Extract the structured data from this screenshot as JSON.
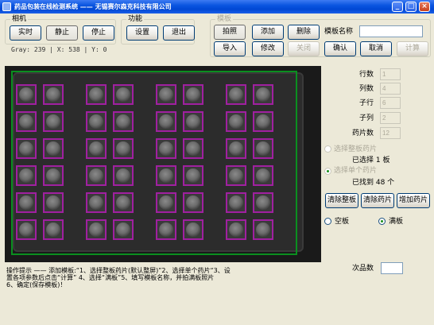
{
  "window": {
    "title": "药品包装在线检测系统  ——  无锡赛尔森克科技有限公司"
  },
  "camera_group": {
    "legend": "相机",
    "realtime_label": "实时",
    "still_label": "静止",
    "stop_label": "停止"
  },
  "function_group": {
    "legend": "功能",
    "settings_label": "设置",
    "exit_label": "退出"
  },
  "template_group": {
    "legend": "模板",
    "capture_label": "拍照",
    "add_label": "添加",
    "delete_label": "删除",
    "name_label": "模板名称",
    "name_value": "",
    "import_label": "导入",
    "modify_label": "修改",
    "close_label": "关闭",
    "confirm_label": "确认",
    "cancel_label": "取消",
    "calculate_label": "计算"
  },
  "status_bar": {
    "text": "Gray: 239 | X: 538 | Y: 0"
  },
  "params": [
    {
      "label": "行数",
      "value": "1"
    },
    {
      "label": "列数",
      "value": "4"
    },
    {
      "label": "子行",
      "value": "6"
    },
    {
      "label": "子列",
      "value": "2"
    },
    {
      "label": "药片数",
      "value": "12"
    }
  ],
  "selection": {
    "select_whole_label": "选择整板药片",
    "selected_boards": "已选择 1 板",
    "select_single_label": "选择单个药片",
    "found_count": "已找到 48 个"
  },
  "actions": {
    "clear_board_label": "清除整板",
    "clear_pill_label": "清除药片",
    "add_pill_label": "增加药片"
  },
  "board_mode": {
    "empty_label": "空板",
    "full_label": "满板",
    "selected": "满板"
  },
  "defects": {
    "label": "次品数",
    "value": ""
  },
  "tips": {
    "text": "操作提示 —— 添加模板:“1、选择整板药片(默认整屏)”2、选择单个药片“3、设\n置各项参数后点击“计算” 4、选择“满板”5、填写模板名称，并拍满板照片\n6、确定(保存模板)！"
  },
  "colors": {
    "roi_box": "#0a8f1f",
    "pill_box": "#a020a0"
  },
  "icons": {
    "app": "app-icon",
    "minimize": "minimize-icon",
    "maximize": "maximize-icon",
    "close": "close-icon"
  }
}
